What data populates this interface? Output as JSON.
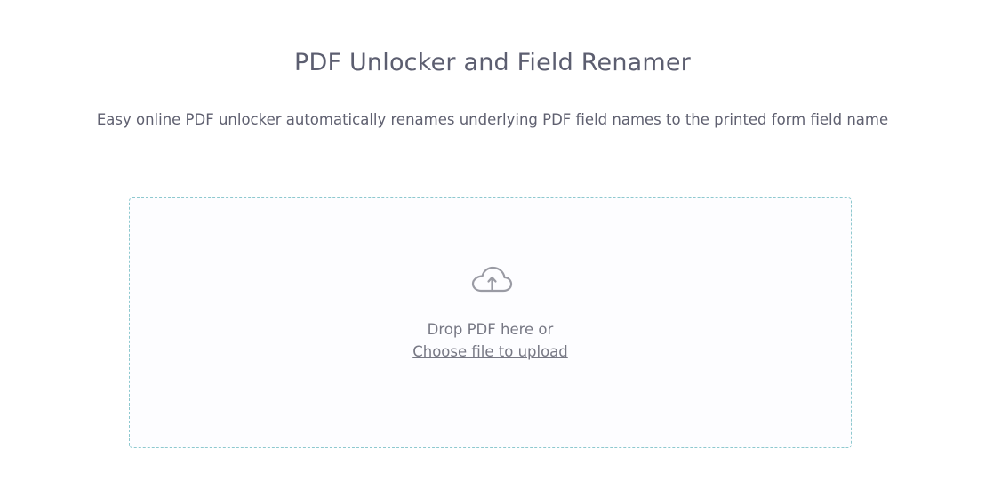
{
  "header": {
    "title": "PDF Unlocker and Field Renamer",
    "subtitle": "Easy online PDF unlocker automatically renames underlying PDF field names to the printed form field name"
  },
  "upload": {
    "icon": "cloud-upload-icon",
    "drop_text": "Drop PDF here or",
    "choose_link": "Choose file to upload"
  },
  "colors": {
    "title": "#5c5e70",
    "dropzone_border": "#8ec9cf",
    "dropzone_bg": "#fdfdff",
    "muted_text": "#777884"
  }
}
